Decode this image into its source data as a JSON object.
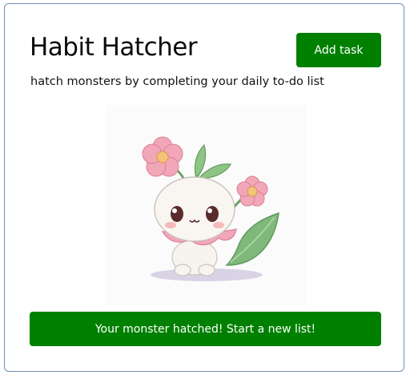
{
  "app": {
    "title": "Habit Hatcher",
    "subtitle": "hatch monsters by completing your daily to-do list"
  },
  "header": {
    "add_task_label": "Add task"
  },
  "monster": {
    "icon": "sprout-monster-illustration",
    "state": "hatched"
  },
  "footer": {
    "hatch_button_label": "Your monster hatched! Start a new list!"
  },
  "colors": {
    "button_green": "#008000",
    "card_border": "#6f8fb6",
    "petal_pink": "#f2a7b8",
    "leaf_green": "#7fb87a"
  }
}
